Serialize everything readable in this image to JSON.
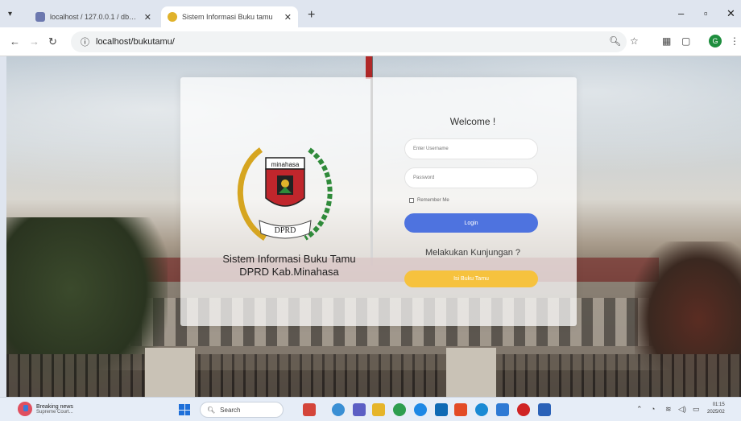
{
  "browser": {
    "tabs": [
      {
        "title": "localhost / 127.0.0.1 / dbbuku...",
        "active": false
      },
      {
        "title": "Sistem Informasi Buku tamu",
        "active": true
      }
    ],
    "url": "localhost/bukutamu/",
    "window_controls": [
      "–",
      "▫",
      "✕"
    ],
    "profile_initial": "G"
  },
  "page": {
    "welcome": "Welcome !",
    "username_placeholder": "Enter Username",
    "password_placeholder": "Password",
    "remember_label": "Remember Me",
    "login_button": "Login",
    "question": "Melakukan Kunjungan ?",
    "visit_button": "Isi Buku Tamu",
    "org_title_line1": "Sistem Informasi Buku Tamu",
    "org_title_line2": "DPRD Kab.Minahasa",
    "logo_banner_top": "minahasa",
    "logo_banner_bottom": "DPRD"
  },
  "taskbar": {
    "news_title": "Breaking news",
    "news_subtitle": "Supreme Court...",
    "search_label": "Search",
    "time": "01:15",
    "date": "2025/02"
  },
  "colors": {
    "login": "#4e73df",
    "visit": "#f6c23e",
    "card": "rgba(255,255,255,0.72)"
  }
}
